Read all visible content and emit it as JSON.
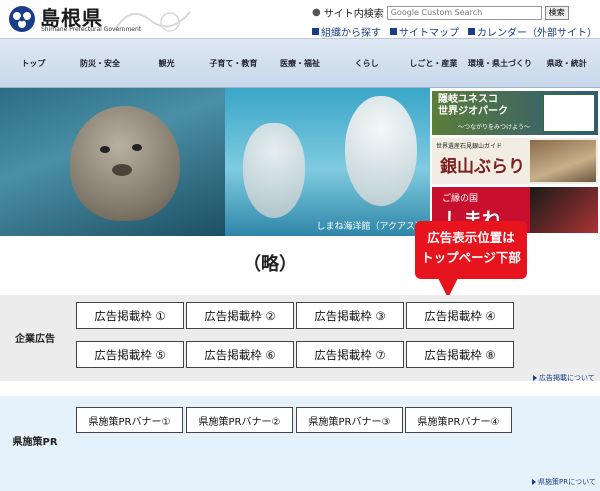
{
  "header": {
    "logo_title": "島根県",
    "logo_subtitle": "Shimane Prefectural Government",
    "search_label": "サイト内検索",
    "search_placeholder": "Google Custom Search",
    "search_button": "検索",
    "links": [
      "組織から探す",
      "サイトマップ",
      "カレンダー（外部サイト）"
    ]
  },
  "nav": {
    "items": [
      "トップ",
      "防災・安全",
      "観光",
      "子育て・教育",
      "医療・福祉",
      "くらし",
      "しごと・産業",
      "環境・県土づくり",
      "県政・統計"
    ]
  },
  "hero": {
    "caption": "しまね海洋館（アクアス）",
    "banners": {
      "geopark_title": "隠岐ユネスコ\n世界ジオパーク",
      "geopark_sub": "〜つながりをみつけよう〜",
      "ginzan_top": "世界遺産石見銀山ガイド",
      "ginzan_main": "銀山ぶらり",
      "shimane_small": "ご縁の国",
      "shimane_main": "しまね"
    }
  },
  "omitted_text": "（略）",
  "callout": {
    "line1": "広告表示位置は",
    "line2": "トップページ下部"
  },
  "corporate_ads": {
    "label": "企業広告",
    "slots": [
      "広告掲載枠 ①",
      "広告掲載枠 ②",
      "広告掲載枠 ③",
      "広告掲載枠 ④",
      "広告掲載枠 ⑤",
      "広告掲載枠 ⑥",
      "広告掲載枠 ⑦",
      "広告掲載枠 ⑧"
    ],
    "more_link": "広告掲載について"
  },
  "policy_pr": {
    "label": "県施策PR",
    "slots": [
      "県施策PRバナー①",
      "県施策PRバナー②",
      "県施策PRバナー③",
      "県施策PRバナー④"
    ],
    "more_link": "県施策PRについて"
  },
  "colors": {
    "nav_bg": "#c7d7ea",
    "callout_red": "#e8141d",
    "link_blue": "#1a3c8a",
    "corp_bg": "#ececec",
    "pr_bg": "#e6f2fb"
  }
}
